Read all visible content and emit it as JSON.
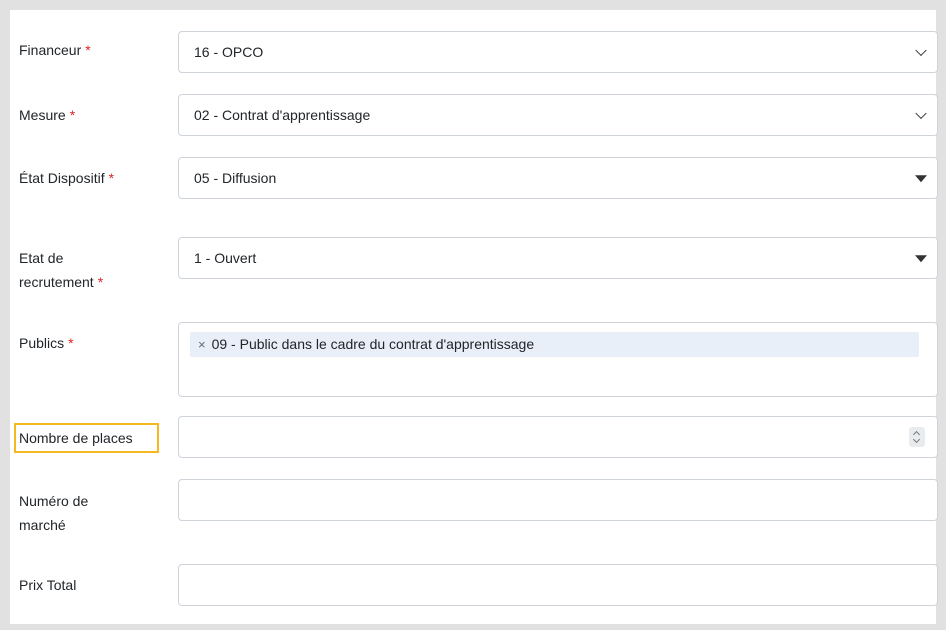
{
  "form": {
    "financeur": {
      "label": "Financeur",
      "required": "*",
      "value": "16 - OPCO"
    },
    "mesure": {
      "label": "Mesure",
      "required": "*",
      "value": "02 - Contrat d'apprentissage"
    },
    "etat_dispositif": {
      "label": "État Dispositif",
      "required": "*",
      "value": "05 - Diffusion"
    },
    "etat_recrutement": {
      "label_line1": "Etat de",
      "label_line2": "recrutement",
      "required": "*",
      "value": "1 - Ouvert"
    },
    "publics": {
      "label": "Publics",
      "required": "*",
      "tags": [
        {
          "remove": "×",
          "text": "09 - Public dans le cadre du contrat d'apprentissage"
        }
      ]
    },
    "nombre_places": {
      "label": "Nombre de places",
      "value": ""
    },
    "numero_marche": {
      "label_line1": "Numéro de",
      "label_line2": "marché",
      "value": ""
    },
    "prix_total": {
      "label": "Prix Total",
      "value": ""
    }
  },
  "colors": {
    "required": "#e02424",
    "highlight": "#f5b820",
    "tag_bg": "#e8eff8",
    "border": "#ced4da"
  }
}
